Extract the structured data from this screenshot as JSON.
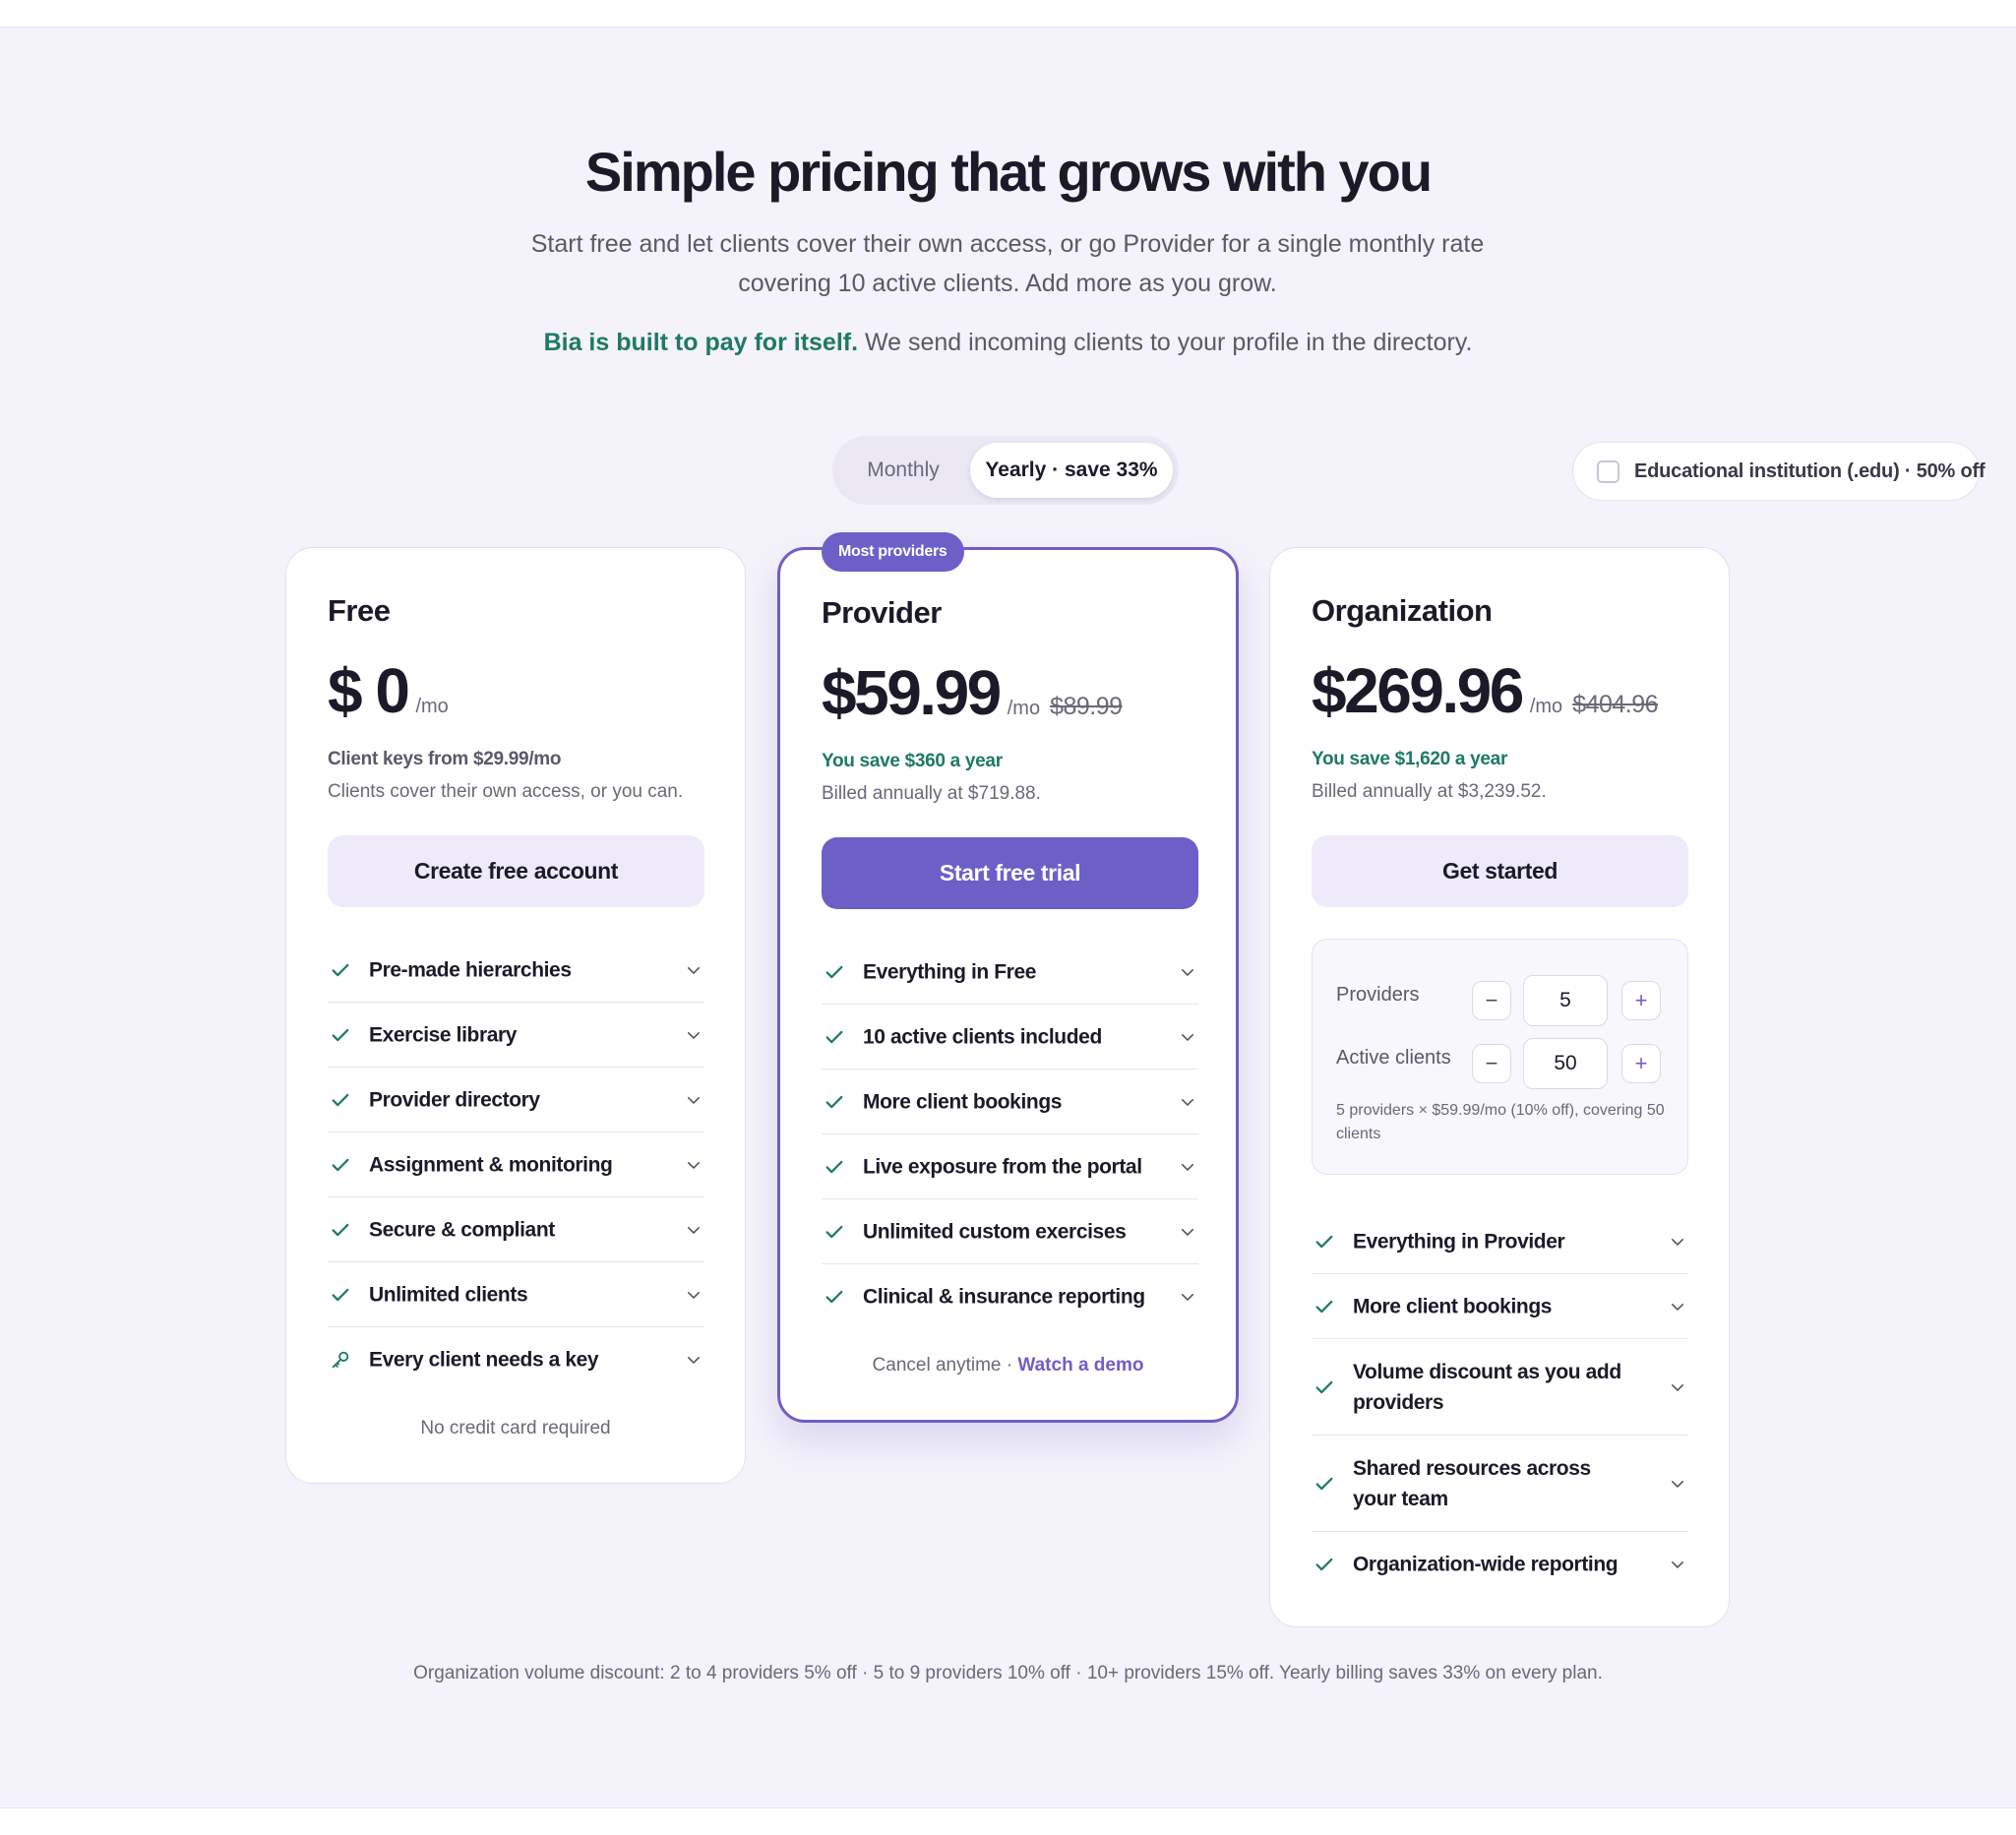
{
  "header": {
    "title": "Simple pricing that grows with you",
    "subtitle": "Start free and let clients cover their own access, or go Provider for a single monthly rate covering 10 active clients. Add more as you grow.",
    "tagline_accent": "Bia is built to pay for itself.",
    "tagline_rest": " We send incoming clients to your profile in the directory."
  },
  "billing_toggle": {
    "monthly_label": "Monthly",
    "yearly_label": "Yearly · save 33%",
    "selected": "Yearly · save 33%"
  },
  "edu_option": {
    "label": "Educational institution (.edu) · 50% off",
    "checked": false
  },
  "plans": {
    "free": {
      "name": "Free",
      "price": "$ 0",
      "per": "/mo",
      "note1": "Client keys from $29.99/mo",
      "note2": "Clients cover their own access, or you can.",
      "cta": "Create free account",
      "features": [
        "Pre-made hierarchies",
        "Exercise library",
        "Provider directory",
        "Assignment & monitoring",
        "Secure & compliant",
        "Unlimited clients",
        "Every client needs a key"
      ],
      "footnote": "No credit card required"
    },
    "provider": {
      "badge": "Most providers",
      "name": "Provider",
      "price": "$59.99",
      "per": "/mo",
      "strike": "$89.99",
      "note1": "You save $360 a year",
      "note2": "Billed annually at $719.88.",
      "cta": "Start free trial",
      "features": [
        "Everything in Free",
        "10 active clients included",
        "More client bookings",
        "Live exposure from the portal",
        "Unlimited custom exercises",
        "Clinical & insurance reporting"
      ],
      "footnote_text": "Cancel anytime · ",
      "footnote_link": "Watch a demo"
    },
    "org": {
      "name": "Organization",
      "price": "$269.96",
      "per": "/mo",
      "strike": "$404.96",
      "note1": "You save $1,620 a year",
      "note2": "Billed annually at $3,239.52.",
      "cta": "Get started",
      "calculator": {
        "providers_label": "Providers",
        "providers_value": "5",
        "clients_label": "Active clients",
        "clients_value": "50",
        "minus": "−",
        "plus": "+",
        "note": "5 providers × $59.99/mo (10% off), covering 50 clients"
      },
      "features": [
        "Everything in Provider",
        "More client bookings",
        "Volume discount as you add providers",
        "Shared resources across your team",
        "Organization-wide reporting"
      ]
    }
  },
  "bottom_note": "Organization volume discount: 2 to 4 providers 5% off · 5 to 9 providers 10% off · 10+ providers 15% off. Yearly billing saves 33% on every plan.",
  "colors": {
    "accent": "#6c5fc7",
    "green": "#1e7a64",
    "background": "#f4f2fa"
  }
}
